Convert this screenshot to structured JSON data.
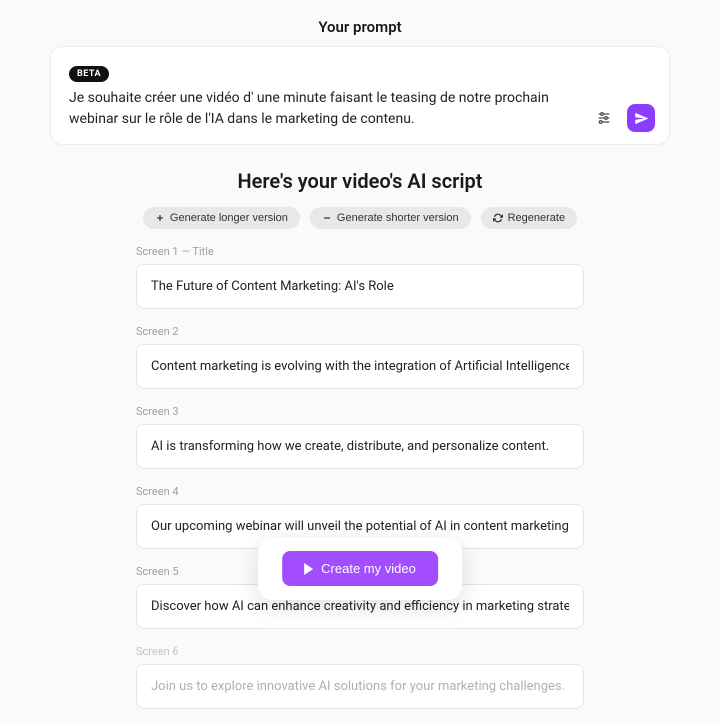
{
  "prompt_section": {
    "title": "Your prompt",
    "beta_label": "BETA",
    "text": "Je souhaite créer une vidéo d' une minute faisant le teasing de notre prochain webinar sur le rôle de l'IA dans le marketing de contenu."
  },
  "script_section": {
    "title": "Here's your video's AI script",
    "actions": {
      "longer": "Generate longer version",
      "shorter": "Generate shorter version",
      "regenerate": "Regenerate"
    }
  },
  "screens": [
    {
      "label": "Screen 1 — Title",
      "text": "The Future of Content Marketing: AI's Role"
    },
    {
      "label": "Screen 2",
      "text": "Content marketing is evolving with the integration of Artificial Intelligence."
    },
    {
      "label": "Screen 3",
      "text": "AI is transforming how we create, distribute, and personalize content."
    },
    {
      "label": "Screen 4",
      "text": "Our upcoming webinar will unveil the potential of AI in content marketing."
    },
    {
      "label": "Screen 5",
      "text": "Discover how AI can enhance creativity and efficiency in marketing strategies."
    },
    {
      "label": "Screen 6",
      "text": "Join us to explore innovative AI solutions for your marketing challenges."
    }
  ],
  "cta": {
    "label": "Create my video"
  },
  "colors": {
    "accent": "#8b3dff",
    "cta": "#a24dff"
  }
}
